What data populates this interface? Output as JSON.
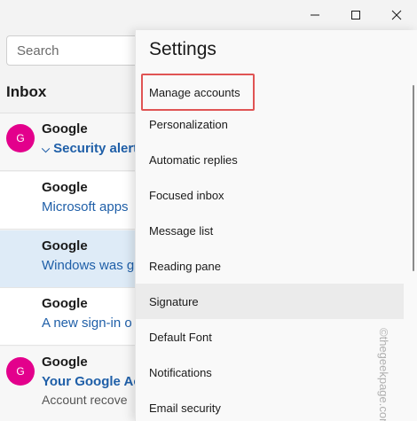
{
  "window": {
    "caption_icons": [
      "minimize-icon",
      "maximize-icon",
      "close-icon"
    ]
  },
  "search": {
    "placeholder": "Search"
  },
  "inbox": {
    "title": "Inbox",
    "mails": [
      {
        "avatar": "G",
        "sender": "Google",
        "subject": "Security alert",
        "subject_prefix": "⌵",
        "preview": ""
      },
      {
        "avatar": "",
        "sender": "Google",
        "subject": "Microsoft apps",
        "preview": ""
      },
      {
        "avatar": "",
        "sender": "Google",
        "subject": "Windows was g",
        "preview": ""
      },
      {
        "avatar": "",
        "sender": "Google",
        "subject": "A new sign-in o",
        "preview": ""
      },
      {
        "avatar": "G",
        "sender": "Google",
        "subject": "Your Google Ac",
        "preview": "Account recove"
      }
    ]
  },
  "settings": {
    "title": "Settings",
    "items": [
      "Manage accounts",
      "Personalization",
      "Automatic replies",
      "Focused inbox",
      "Message list",
      "Reading pane",
      "Signature",
      "Default Font",
      "Notifications",
      "Email security"
    ]
  },
  "watermark": "©thegeekpage.com",
  "colors": {
    "accent": "#1f5fa8",
    "avatar": "#e3008c",
    "highlight": "#e05454",
    "selected_row": "#deebf7"
  }
}
